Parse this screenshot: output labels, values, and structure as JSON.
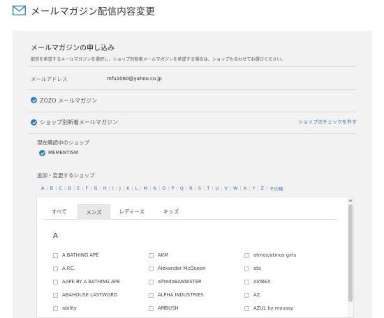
{
  "header": {
    "title": "メールマガジン配信内容変更",
    "icon": "mail-icon"
  },
  "section": {
    "title": "メールマガジンの申し込み",
    "description": "配信を希望するメールマガジンを選択し、ショップ別新着メールマガジンを希望する場合は、ショップも合わせてお選びください。"
  },
  "email": {
    "label": "メールアドレス",
    "value": "mfu1060@yahoo.co.jp"
  },
  "options": {
    "zozo": {
      "label": "ZOZO メールマガジン",
      "checked": true
    },
    "shop_new": {
      "label": "ショップ別新着メールマガジン",
      "checked": true,
      "uncheck_link": "ショップのチェックを外す"
    }
  },
  "current_shops": {
    "label": "現在購読中のショップ",
    "items": [
      "MEMENTISM"
    ]
  },
  "add_shops": {
    "label": "追加・変更するショップ",
    "letters": [
      "A",
      "B",
      "C",
      "D",
      "E",
      "F",
      "G",
      "H",
      "I",
      "J",
      "K",
      "L",
      "M",
      "N",
      "O",
      "P",
      "Q",
      "R",
      "S",
      "T",
      "U",
      "V",
      "W",
      "X",
      "Y",
      "Z",
      "その他"
    ]
  },
  "tabs": [
    {
      "label": "すべて",
      "active": false
    },
    {
      "label": "メンズ",
      "active": true
    },
    {
      "label": "レディース",
      "active": false
    },
    {
      "label": "キッズ",
      "active": false
    }
  ],
  "brand_group": {
    "heading": "A",
    "columns": [
      [
        "A BATHING APE",
        "A.P.C.",
        "AAPE BY A BATHING APE",
        "ABAHOUSE LASTWORD",
        "ability"
      ],
      [
        "AKM",
        "Alexander McQueen",
        "alfredoBANNISTER",
        "ALPHA INDUSTRIES",
        "AMBUSH"
      ],
      [
        "atmos/atmos girls",
        "ato",
        "AVIREX",
        "AZ",
        "AZUL by moussy"
      ]
    ]
  },
  "colors": {
    "accent": "#2b7fc1",
    "link": "#2b6fb5",
    "panel_bg": "#f2f2f2"
  }
}
